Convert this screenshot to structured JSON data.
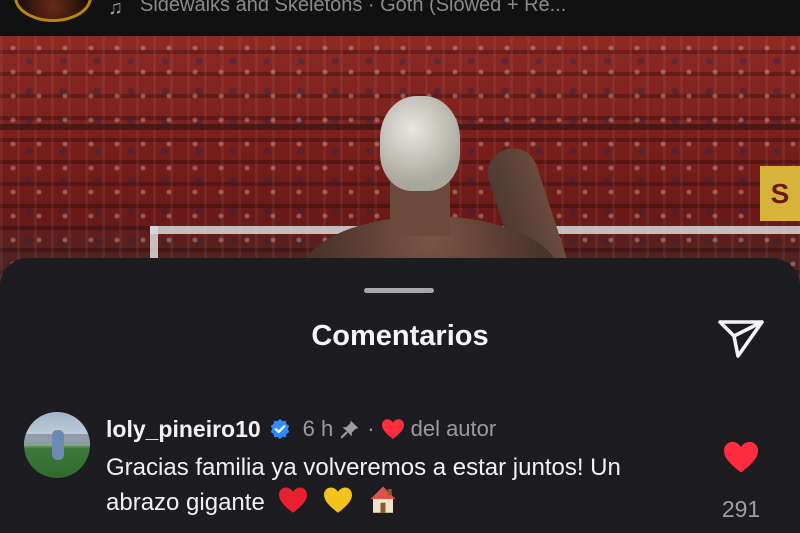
{
  "audio": {
    "note_icon": "music-note-icon",
    "track_text": "Sidewalks and Skeletons · Goth (Slowed + Re..."
  },
  "media": {
    "banner_letter": "S"
  },
  "sheet": {
    "title": "Comentarios",
    "share_icon": "send-icon"
  },
  "comment": {
    "username": "loly_pineiro10",
    "verified_icon": "verified-badge-icon",
    "time": "6 h",
    "pin_icon": "pin-icon",
    "separator": "·",
    "liked_by_author_label": "del autor",
    "text": "Gracias familia ya volveremos a estar juntos! Un abrazo gigante",
    "emojis": [
      "red-heart",
      "yellow-heart",
      "house"
    ],
    "like_count": "291"
  },
  "colors": {
    "accent_red": "#ff2d3d",
    "verified_blue": "#2f8cff",
    "sheet_bg": "#1d1d21"
  }
}
